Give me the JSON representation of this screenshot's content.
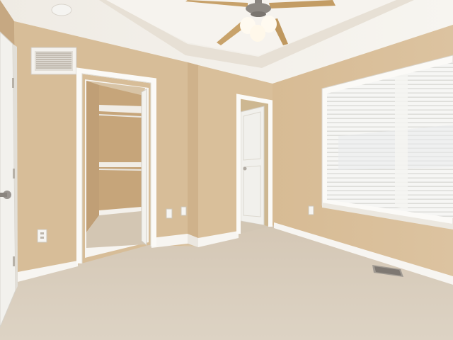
{
  "scene": {
    "description_free": true,
    "colors": {
      "wall": "#d8bf9b",
      "wall_shadow": "#c9ac85",
      "ceiling": "#f3efe9",
      "carpet": "#d8cdbd",
      "trim": "#fbfaf7",
      "door": "#f1f0ec",
      "closet_interior": "#c8a97f",
      "window_blinds": "#f7f7f5",
      "fan_blade": "#c8a26a"
    },
    "icons": {
      "ceiling_fan": "ceiling-fan-icon",
      "light": "light-bulb-icon",
      "vent": "air-vent-icon",
      "outlet": "power-outlet-icon",
      "door_knob": "door-knob-icon"
    }
  }
}
